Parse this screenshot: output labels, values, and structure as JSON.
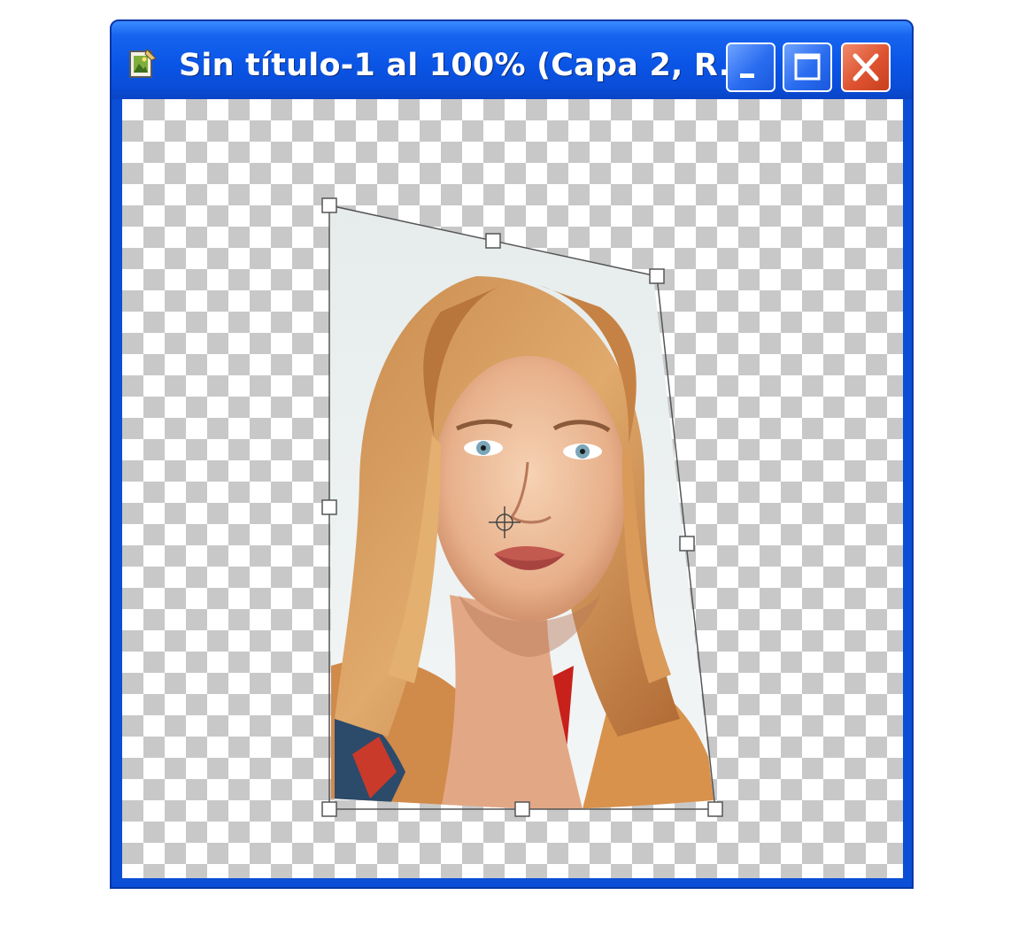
{
  "window": {
    "title": "Sin título-1 al 100% (Capa 2, R...",
    "app_icon": "photoshop-document-icon",
    "controls": {
      "minimize_icon": "minimize-icon",
      "maximize_icon": "maximize-icon",
      "close_icon": "close-icon"
    }
  },
  "canvas": {
    "background": "transparency-checkerboard",
    "layer": "portrait-photo-layer",
    "transform_tool": "free-transform-bounding-box",
    "reference_point_icon": "crosshair-icon"
  },
  "colors": {
    "title_bar": "#0a55e6",
    "close_button": "#de5230",
    "checker_dark": "#c8c8c8",
    "checker_light": "#ffffff"
  }
}
